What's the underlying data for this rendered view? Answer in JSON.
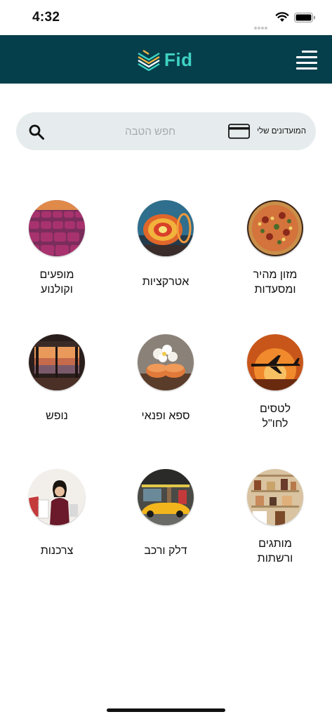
{
  "status_bar": {
    "time": "4:32"
  },
  "header": {
    "brand": "Fid",
    "brand_color": "#3fd3c4",
    "background": "#063f4c"
  },
  "search": {
    "placeholder": "חפש הטבה",
    "value": "",
    "clubs_label": "המועדונים שלי"
  },
  "categories": [
    {
      "label_line1": "מזון מהיר",
      "label_line2": "ומסעדות",
      "icon": "pizza-image"
    },
    {
      "label_line1": "אטרקציות",
      "label_line2": "",
      "icon": "amusement-ride-image"
    },
    {
      "label_line1": "מופעים",
      "label_line2": "וקולנוע",
      "icon": "theater-seats-image"
    },
    {
      "label_line1": "לטסים",
      "label_line2": "לחו\"ל",
      "icon": "airplane-image"
    },
    {
      "label_line1": "ספא ופנאי",
      "label_line2": "",
      "icon": "spa-towels-image"
    },
    {
      "label_line1": "נופש",
      "label_line2": "",
      "icon": "beach-pier-image"
    },
    {
      "label_line1": "מותגים",
      "label_line2": "ורשתות",
      "icon": "fashion-store-image"
    },
    {
      "label_line1": "דלק ורכב",
      "label_line2": "",
      "icon": "sports-car-image"
    },
    {
      "label_line1": "צרכנות",
      "label_line2": "",
      "icon": "shopping-woman-image"
    }
  ]
}
